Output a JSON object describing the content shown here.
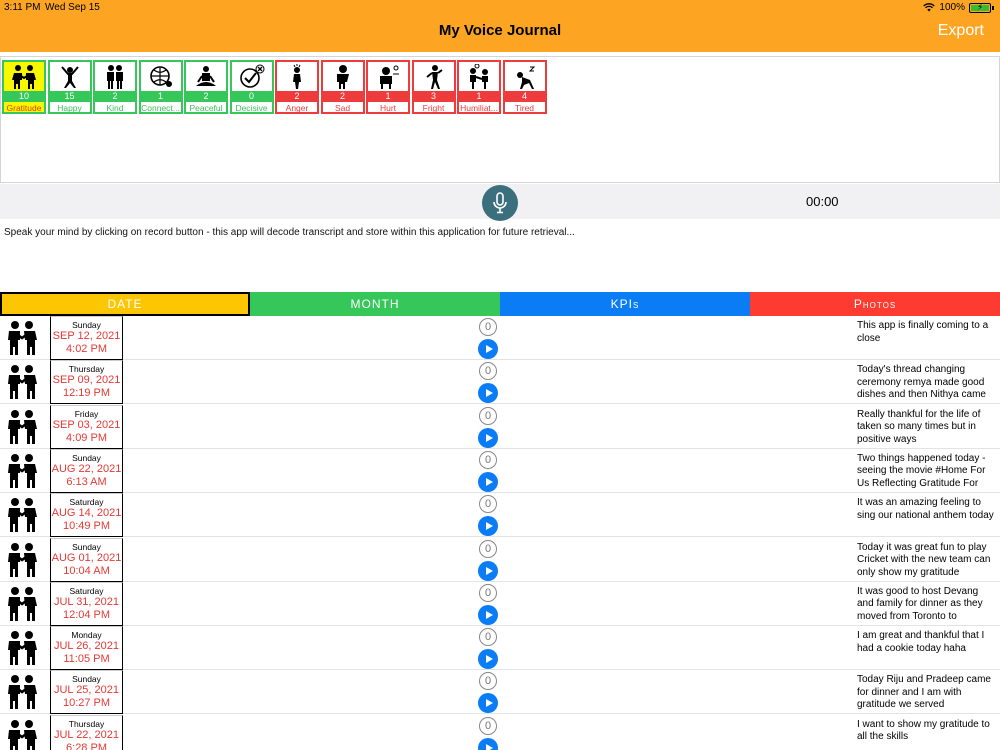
{
  "status": {
    "time": "3:11 PM",
    "date": "Wed Sep 15",
    "battery": "100%",
    "battery_level": 1.0,
    "wifi_icon": "wifi-icon",
    "battery_icon": "battery-charging-icon"
  },
  "header": {
    "title": "My Voice Journal",
    "export_label": "Export"
  },
  "colors": {
    "header_bg": "#fda523",
    "positive": "#35c759",
    "negative": "#ee3b3b",
    "date_tab": "#fcc603",
    "month_tab": "#35c759",
    "kpis_tab": "#0a7cf5",
    "photos_tab": "#fd3b30"
  },
  "moods": [
    {
      "label": "Gratitude",
      "count": "10",
      "icon": "gratitude-icon",
      "type": "positive",
      "selected": true
    },
    {
      "label": "Happy",
      "count": "15",
      "icon": "happy-icon",
      "type": "positive"
    },
    {
      "label": "Kind",
      "count": "2",
      "icon": "kind-icon",
      "type": "positive"
    },
    {
      "label": "Connect...",
      "count": "1",
      "icon": "connected-icon",
      "type": "positive"
    },
    {
      "label": "Peaceful",
      "count": "2",
      "icon": "peaceful-icon",
      "type": "positive"
    },
    {
      "label": "Decisive",
      "count": "0",
      "icon": "decisive-icon",
      "type": "positive"
    },
    {
      "label": "Anger",
      "count": "2",
      "icon": "anger-icon",
      "type": "negative"
    },
    {
      "label": "Sad",
      "count": "2",
      "icon": "sad-icon",
      "type": "negative"
    },
    {
      "label": "Hurt",
      "count": "1",
      "icon": "hurt-icon",
      "type": "negative"
    },
    {
      "label": "Fright",
      "count": "3",
      "icon": "fright-icon",
      "type": "negative"
    },
    {
      "label": "Humiliat...",
      "count": "1",
      "icon": "humiliated-icon",
      "type": "negative"
    },
    {
      "label": "Tired",
      "count": "4",
      "icon": "tired-icon",
      "type": "negative"
    }
  ],
  "recorder": {
    "timer": "00:00",
    "mic_icon": "microphone-icon"
  },
  "hint": "Speak your mind by clicking on record button  - this app will decode transcript and store within this application for future retrieval...",
  "tabs": {
    "date": "DATE",
    "month": "MONTH",
    "kpis": "KPIs",
    "photos": "Photos"
  },
  "entries": [
    {
      "day": "Sunday",
      "date": "SEP 12, 2021",
      "time": "4:02 PM",
      "count": "0",
      "note": "This app is finally coming to a close"
    },
    {
      "day": "Thursday",
      "date": "SEP 09, 2021",
      "time": "12:19 PM",
      "count": "0",
      "note": "Today's thread changing ceremony remya made good dishes and then Nithya came"
    },
    {
      "day": "Friday",
      "date": "SEP 03, 2021",
      "time": "4:09 PM",
      "count": "0",
      "note": "Really thankful for the life of taken so many times but in positive ways"
    },
    {
      "day": "Sunday",
      "date": "AUG 22, 2021",
      "time": "6:13 AM",
      "count": "0",
      "note": "Two things happened today - seeing the movie #Home For Us Reflecting Gratitude For"
    },
    {
      "day": "Saturday",
      "date": "AUG 14, 2021",
      "time": "10:49 PM",
      "count": "0",
      "note": "It was an amazing feeling to sing our national anthem today"
    },
    {
      "day": "Sunday",
      "date": "AUG 01, 2021",
      "time": "10:04 AM",
      "count": "0",
      "note": "Today it was great fun to play Cricket with the new team can only show my gratitude"
    },
    {
      "day": "Saturday",
      "date": "JUL 31, 2021",
      "time": "12:04 PM",
      "count": "0",
      "note": "It was good to host Devang and family for dinner as they moved from Toronto to"
    },
    {
      "day": "Monday",
      "date": "JUL 26, 2021",
      "time": "11:05 PM",
      "count": "0",
      "note": "I am great and thankful that I had a cookie today haha"
    },
    {
      "day": "Sunday",
      "date": "JUL 25, 2021",
      "time": "10:27 PM",
      "count": "0",
      "note": "Today Riju and Pradeep came for dinner and I am with gratitude we served"
    },
    {
      "day": "Thursday",
      "date": "JUL 22, 2021",
      "time": "6:28 PM",
      "count": "0",
      "note": "I want to show my gratitude to all the skills"
    }
  ]
}
